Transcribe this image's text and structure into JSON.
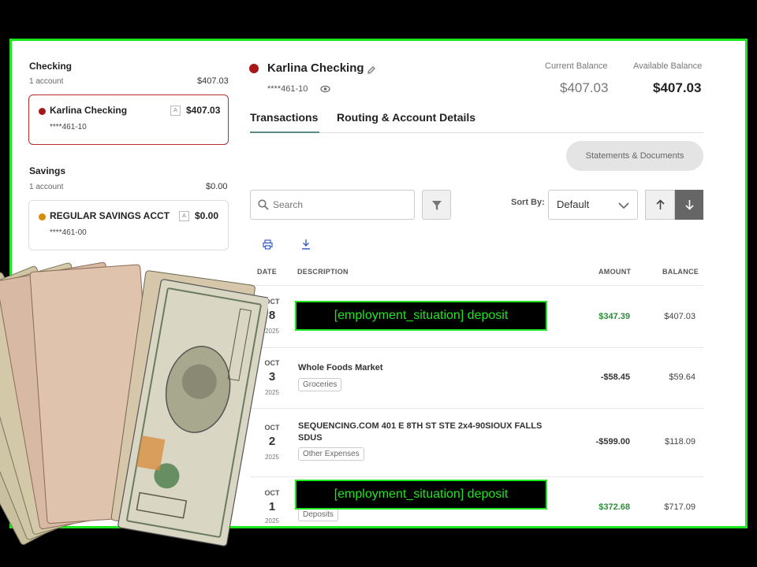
{
  "sidebar": {
    "checking": {
      "title": "Checking",
      "count": "1 account",
      "total": "$407.03",
      "account": {
        "name": "Karlina Checking",
        "mask": "****461-10",
        "balance": "$407.03",
        "badge": "A"
      }
    },
    "savings": {
      "title": "Savings",
      "count": "1 account",
      "total": "$0.00",
      "account": {
        "name": "REGULAR SAVINGS ACCT",
        "mask": "****461-00",
        "balance": "$0.00",
        "badge": "A"
      }
    }
  },
  "header": {
    "account_name": "Karlina Checking",
    "mask": "****461-10",
    "current_label": "Current Balance",
    "current_value": "$407.03",
    "available_label": "Available Balance",
    "available_value": "$407.03"
  },
  "tabs": [
    {
      "label": "Transactions"
    },
    {
      "label": "Routing & Account Details"
    }
  ],
  "toolbar": {
    "statements_label": "Statements & Documents",
    "search_placeholder": "Search",
    "sort_label": "Sort By:",
    "sort_value": "Default"
  },
  "table": {
    "headers": {
      "date": "DATE",
      "description": "DESCRIPTION",
      "amount": "AMOUNT",
      "balance": "BALANCE"
    },
    "rows": [
      {
        "month": "OCT",
        "day": "8",
        "year": "2025",
        "description": "[employment_situation] deposit",
        "category": "",
        "amount": "$347.39",
        "balance": "$407.03"
      },
      {
        "month": "OCT",
        "day": "3",
        "year": "2025",
        "description": "Whole Foods Market",
        "category": "Groceries",
        "amount": "-$58.45",
        "balance": "$59.64"
      },
      {
        "month": "OCT",
        "day": "2",
        "year": "2025",
        "description": "SEQUENCING.COM 401 E 8TH ST STE 2x4-90SIOUX FALLS SDUS",
        "category": "Other Expenses",
        "amount": "-$599.00",
        "balance": "$118.09"
      },
      {
        "month": "OCT",
        "day": "1",
        "year": "2025",
        "description": "[employment_situation] deposit",
        "category": "Deposits",
        "amount": "$372.68",
        "balance": "$717.09"
      }
    ]
  },
  "colors": {
    "accent": "#1ee61e",
    "selected_border": "#b52a2a",
    "positive": "#2e8b3a",
    "checking_dot": "#a81818",
    "savings_dot": "#d98c0a"
  }
}
